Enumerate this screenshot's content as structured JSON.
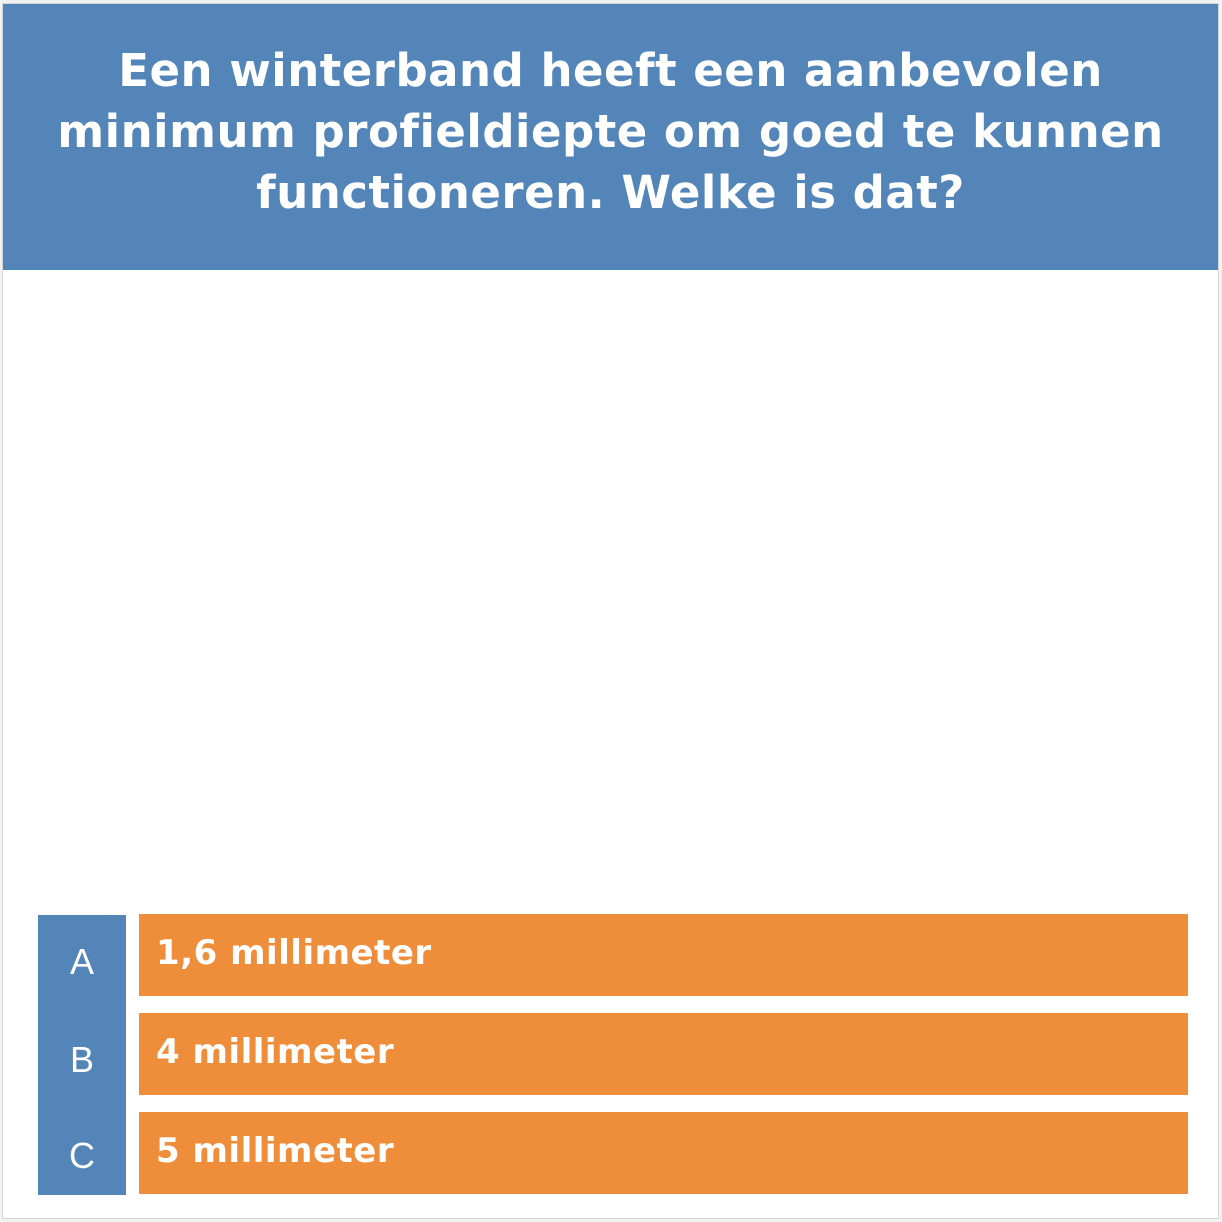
{
  "question": {
    "text": "Een winterband heeft een aanbevolen minimum profieldiepte om goed te kunnen functioneren. Welke is dat?"
  },
  "answers": [
    {
      "letter": "A",
      "label": "1,6 millimeter"
    },
    {
      "letter": "B",
      "label": "4 millimeter"
    },
    {
      "letter": "C",
      "label": "5 millimeter"
    }
  ],
  "colors": {
    "header_background": "#5485b9",
    "letter_column": "#5485b9",
    "answer_background": "#ee8e3b",
    "text": "#ffffff"
  }
}
